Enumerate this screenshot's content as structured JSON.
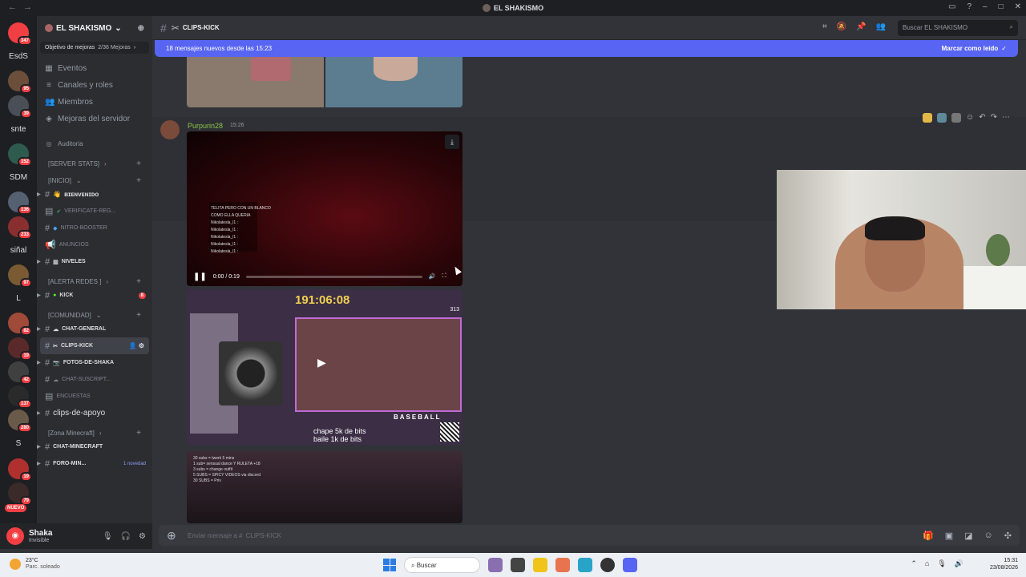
{
  "window": {
    "title": "EL SHAKISMO",
    "back_glyph": "←",
    "forward_glyph": "→"
  },
  "rail": {
    "servers": [
      {
        "name": "discord-home",
        "badge": "347"
      },
      {
        "name": "EsdS",
        "text": "EsdS"
      },
      {
        "name": "server-3",
        "badge": "95"
      },
      {
        "name": "server-4",
        "badge": "39"
      },
      {
        "name": "snte",
        "text": "snte"
      },
      {
        "name": "server-6",
        "badge": "152"
      },
      {
        "name": "SDM",
        "text": "SDM"
      },
      {
        "name": "server-8",
        "badge": "136"
      },
      {
        "name": "server-9",
        "badge": "233"
      },
      {
        "name": "siñal",
        "text": "siñal"
      },
      {
        "name": "server-11",
        "badge": "97"
      },
      {
        "name": "L",
        "text": "L"
      },
      {
        "name": "server-13",
        "badge": "82"
      },
      {
        "name": "server-14",
        "badge": "19"
      },
      {
        "name": "server-15",
        "badge": "42"
      },
      {
        "name": "server-16",
        "badge": "137"
      },
      {
        "name": "server-17",
        "badge": "280"
      },
      {
        "name": "S",
        "text": "S"
      },
      {
        "name": "server-19",
        "badge": "19"
      },
      {
        "name": "server-20",
        "badge": "79"
      }
    ],
    "new_label": "NUEVO"
  },
  "sidebar": {
    "server_name": "EL SHAKISMO",
    "boost_goal": "Objetivo de mejoras",
    "boost_count": "2/36 Mejoras",
    "nav": [
      {
        "label": "Eventos",
        "icon": "calendar-icon"
      },
      {
        "label": "Canales y roles",
        "icon": "channels-icon"
      },
      {
        "label": "Miembros",
        "icon": "members-icon"
      },
      {
        "label": "Mejoras del servidor",
        "icon": "boost-icon"
      }
    ],
    "audit": "Auditoria",
    "categories": {
      "server_stats": "[SERVER STATS]",
      "inicio": "[INICIO]",
      "alerta": "[ALERTA REDES ]",
      "comunidad": "[COMUNIDAD]",
      "minecraft": "[Zona Minecraft]"
    },
    "channels": {
      "bienvenido": "ʙɪᴇɴᴠᴇɴɪᴅᴏ",
      "verificate": "VERIFICATE-REG...",
      "nitro": "NITRO-BOOSTER",
      "anuncios": "ANUNCIOS",
      "niveles": "NIVELES",
      "kick": "KICK",
      "kick_badge": "8",
      "chat_general": "CHAT-GENERAL",
      "clips_kick": "CLIPS-KICK",
      "fotos": "FOTOS-DE-SHAKA",
      "chat_suscript": "CHAT-SUSCRIPT...",
      "encuestas": "ENCUESTAS",
      "clips_apoyo": "clips-de-apoyo",
      "chat_minecraft": "CHAT-MINECRAFT",
      "foro_min": "FORO-MIN...",
      "foro_nov": "1 novedad"
    }
  },
  "user": {
    "name": "Shaka",
    "status": "Invisible"
  },
  "header": {
    "channel": "CLIPS-KICK",
    "search_placeholder": "Buscar EL SHAKISMO"
  },
  "newbar": {
    "text": "18 mensajes nuevos desde las 15:23",
    "action": "Marcar como leído"
  },
  "message": {
    "author": "Purpurin28",
    "time": "15:26",
    "video": {
      "overlay_title": "TELITA PERO CON UN BLANCO COMO ELLA QUERIA",
      "overlay_lines": [
        "Nikolatesla_l1 :",
        "Nikolatesla_l1 :",
        "Nikolatesla_l1 :",
        "Nikolatesla_l1 :",
        "Nikolatesla_l1 :"
      ],
      "time": "0:00 / 0:19",
      "progress": 0.0
    },
    "image2": {
      "counter": "191:06:08",
      "count_badge": "313",
      "caption_line1": "chape 5k de bits",
      "caption_line2": "baile 1k de bits",
      "brand": "BASEBALL"
    },
    "image3_lines": [
      "30 subs = twerk 5 mins",
      "1 sub= sensual dance Y RULETA +18",
      "3 subs = change outfit",
      "5 SUBS = SPICY VIDEOS via discord",
      "30 SUBS = Priv"
    ]
  },
  "composer": {
    "placeholder": "Enviar mensaje a #",
    "channel": "CLIPS-KICK"
  },
  "taskbar": {
    "temp": "23°C",
    "condition": "Parc. soleado",
    "search": "Buscar",
    "time": "15:31",
    "date": "23/08/2026"
  }
}
